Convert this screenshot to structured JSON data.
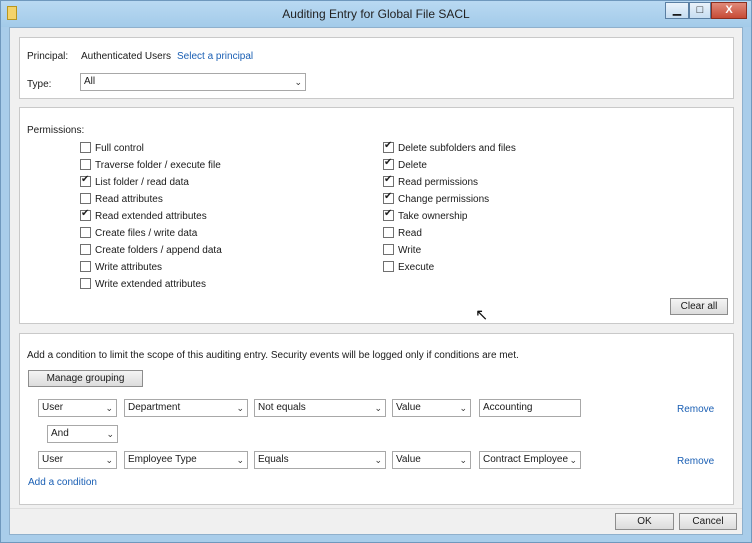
{
  "window": {
    "title": "Auditing Entry for Global File SACL",
    "min_glyph": "▁",
    "max_glyph": "□",
    "close_glyph": "X"
  },
  "principal": {
    "label": "Principal:",
    "value": "Authenticated Users",
    "select_link": "Select a principal",
    "type_label": "Type:",
    "type_value": "All"
  },
  "permissions": {
    "label": "Permissions:",
    "left": [
      {
        "label": "Full control",
        "checked": false
      },
      {
        "label": "Traverse folder / execute file",
        "checked": false
      },
      {
        "label": "List folder / read data",
        "checked": true
      },
      {
        "label": "Read attributes",
        "checked": false
      },
      {
        "label": "Read extended attributes",
        "checked": true
      },
      {
        "label": "Create files / write data",
        "checked": false
      },
      {
        "label": "Create folders / append data",
        "checked": false
      },
      {
        "label": "Write attributes",
        "checked": false
      },
      {
        "label": "Write extended attributes",
        "checked": false
      }
    ],
    "right": [
      {
        "label": "Delete subfolders and files",
        "checked": true
      },
      {
        "label": "Delete",
        "checked": true
      },
      {
        "label": "Read permissions",
        "checked": true
      },
      {
        "label": "Change permissions",
        "checked": true
      },
      {
        "label": "Take ownership",
        "checked": true
      },
      {
        "label": "Read",
        "checked": false
      },
      {
        "label": "Write",
        "checked": false
      },
      {
        "label": "Execute",
        "checked": false
      }
    ],
    "clear_all": "Clear all"
  },
  "conditions": {
    "description": "Add a condition to limit the scope of this auditing entry. Security events will be logged only if conditions are met.",
    "manage_grouping": "Manage grouping",
    "rows": [
      {
        "class": "User",
        "attribute": "Department",
        "operator": "Not equals",
        "value_type": "Value",
        "value": "Accounting",
        "remove": "Remove"
      },
      {
        "class": "User",
        "attribute": "Employee Type",
        "operator": "Equals",
        "value_type": "Value",
        "value": "Contract Employee",
        "remove": "Remove"
      }
    ],
    "connector": "And",
    "add_condition": "Add a condition"
  },
  "footer": {
    "ok": "OK",
    "cancel": "Cancel"
  }
}
